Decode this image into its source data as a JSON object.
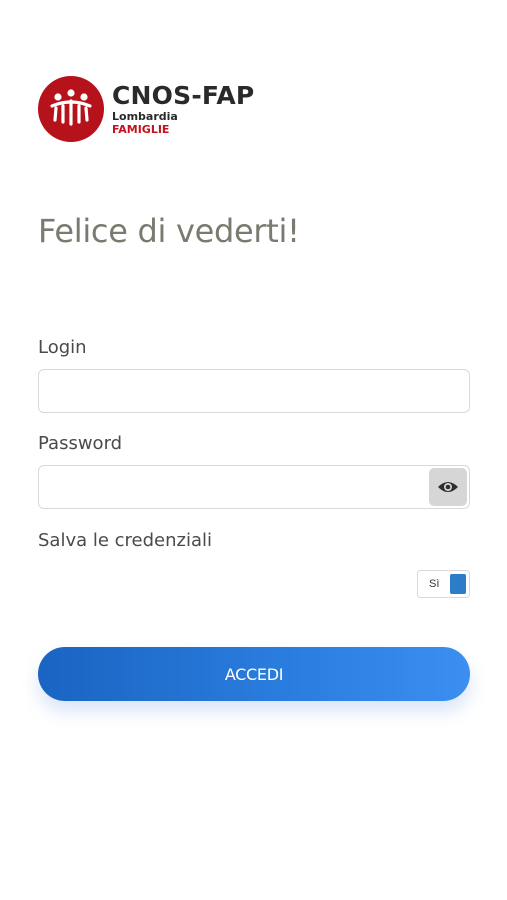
{
  "logo": {
    "brand": "CNOS-FAP",
    "region": "Lombardia",
    "subtitle": "FAMIGLIE",
    "brand_color": "#b5121b"
  },
  "welcome_title": "Felice di vederti!",
  "login": {
    "label": "Login",
    "value": "",
    "placeholder": ""
  },
  "password": {
    "label": "Password",
    "value": "",
    "placeholder": "",
    "toggle_icon": "eye-icon"
  },
  "save_credentials": {
    "label": "Salva le credenziali",
    "toggle_text": "Sì",
    "toggle_on": true,
    "accent_color": "#2d7cc7"
  },
  "submit": {
    "label": "ACCEDI",
    "color": "#2b7ee0"
  }
}
